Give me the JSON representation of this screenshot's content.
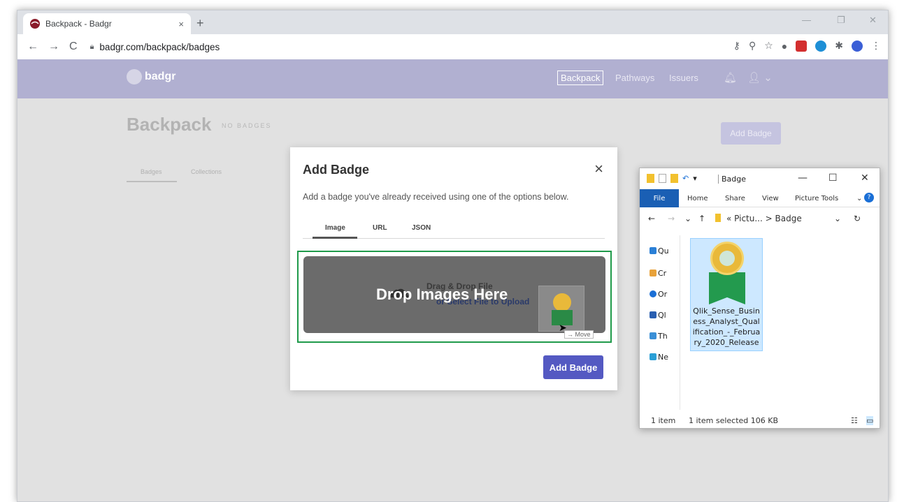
{
  "browser": {
    "tab_title": "Backpack - Badgr",
    "tab_close": "×",
    "new_tab": "+",
    "url": "badgr.com/backpack/badges",
    "window_controls": [
      "—",
      "❐",
      "✕"
    ]
  },
  "site": {
    "logo_text": "badgr",
    "nav": {
      "backpack": "Backpack",
      "pathways": "Pathways",
      "issuers": "Issuers"
    },
    "page_title": "Backpack",
    "page_subtitle": "NO BADGES",
    "add_badge_button": "Add Badge",
    "tabs": [
      "Badges",
      "Collections"
    ]
  },
  "modal": {
    "title": "Add Badge",
    "close": "×",
    "description": "Add a badge you've already received using one of the options below.",
    "tabs": [
      "Image",
      "URL",
      "JSON"
    ],
    "active_tab": "Image",
    "drop_overlay": "Drop Images Here",
    "drop_sub": "Drag & Drop File",
    "drop_sub2": "or Select File to Upload",
    "drag_hint": "→ Move",
    "submit": "Add Badge"
  },
  "explorer": {
    "folder_name": "Badge",
    "ribbon": {
      "file": "File",
      "home": "Home",
      "share": "Share",
      "view": "View",
      "picture_tools": "Picture Tools"
    },
    "breadcrumb": "« Pictu... > Badge",
    "sidebar": [
      "Qu",
      "Cr",
      "Or",
      "Ql",
      "Th",
      "Ne"
    ],
    "file_name": "Qlik_Sense_Business_Analyst_Qualification_-_February_2020_Release",
    "status": {
      "count": "1 item",
      "selected": "1 item selected  106 KB"
    }
  },
  "colors": {
    "header": "#b1b0d1",
    "primary_button": "#5459c2",
    "drop_border": "#1f9a4a",
    "explorer_file_tab": "#1a5fb4"
  }
}
